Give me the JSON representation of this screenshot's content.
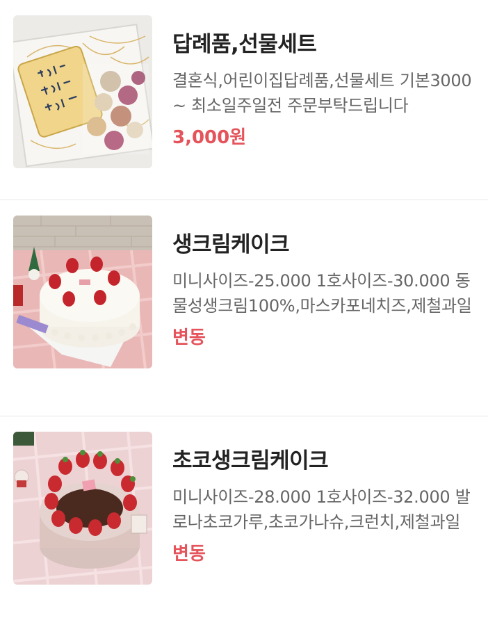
{
  "items": [
    {
      "title": "답례품,선물세트",
      "description": "결혼식,어린이집답례품,선물세트 기본3000~ 최소일주일전 주문부탁드립니다",
      "price": "3,000원",
      "image": "gift-box-photo"
    },
    {
      "title": "생크림케이크",
      "description": "미니사이즈-25.000 1호사이즈-30.000 동물성생크림100%,마스카포네치즈,제철과일",
      "price": "변동",
      "image": "strawberry-cream-cake-photo"
    },
    {
      "title": "초코생크림케이크",
      "description": "미니사이즈-28.000 1호사이즈-32.000 발로나초코가루,초코가나슈,크런치,제철과일",
      "price": "변동",
      "image": "chocolate-cream-cake-photo"
    }
  ],
  "colors": {
    "price": "#e5535b",
    "title": "#222222",
    "description": "#666666",
    "divider": "#e8e8e8"
  }
}
